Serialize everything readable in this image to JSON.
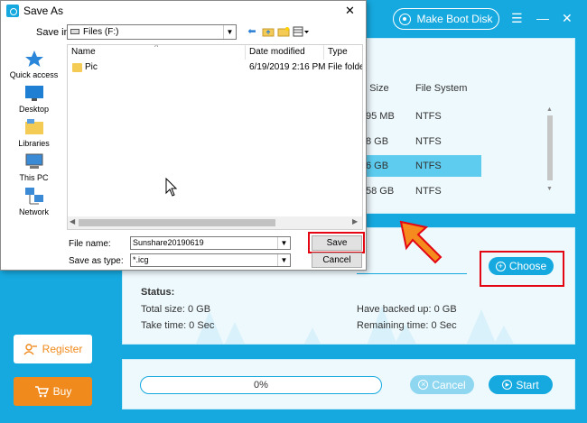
{
  "app": {
    "boot_label": "Make Boot Disk",
    "menu_glyph": "☰",
    "min_glyph": "—",
    "close_glyph": "✕",
    "table": {
      "headers": [
        "e Size",
        "File System"
      ],
      "rows": [
        {
          "size": "95 MB",
          "fs": "NTFS"
        },
        {
          "size": "8 GB",
          "fs": "NTFS"
        },
        {
          "size": "6 GB",
          "fs": "NTFS"
        },
        {
          "size": "58 GB",
          "fs": "NTFS"
        }
      ]
    },
    "choose_label": "Choose",
    "status": {
      "title": "Status:",
      "total_size": "Total size:  0 GB",
      "take_time": "Take time:  0 Sec",
      "backed_up": "Have backed up:  0 GB",
      "remaining": "Remaining time:  0 Sec"
    },
    "progress": "0%",
    "progress_fraction": 0,
    "cancel_label": "Cancel",
    "start_label": "Start",
    "register_label": "Register",
    "buy_label": "Buy",
    "colors": {
      "accent": "#16a9df",
      "orange": "#f08a1c",
      "highlight": "#e30613"
    }
  },
  "dialog": {
    "title": "Save As",
    "close_glyph": "✕",
    "save_in_label": "Save in:",
    "save_in_value": "Files (F:)",
    "places": [
      "Quick access",
      "Desktop",
      "Libraries",
      "This PC",
      "Network"
    ],
    "columns": [
      "Name",
      "Date modified",
      "Type"
    ],
    "files": [
      {
        "name": "Pic",
        "date": "6/19/2019 2:16 PM",
        "type": "File folder"
      }
    ],
    "file_name_label": "File name:",
    "file_name_value": "Sunshare20190619",
    "save_type_label": "Save as type:",
    "save_type_value": "*.icg",
    "save_label": "Save",
    "cancel_label": "Cancel"
  }
}
